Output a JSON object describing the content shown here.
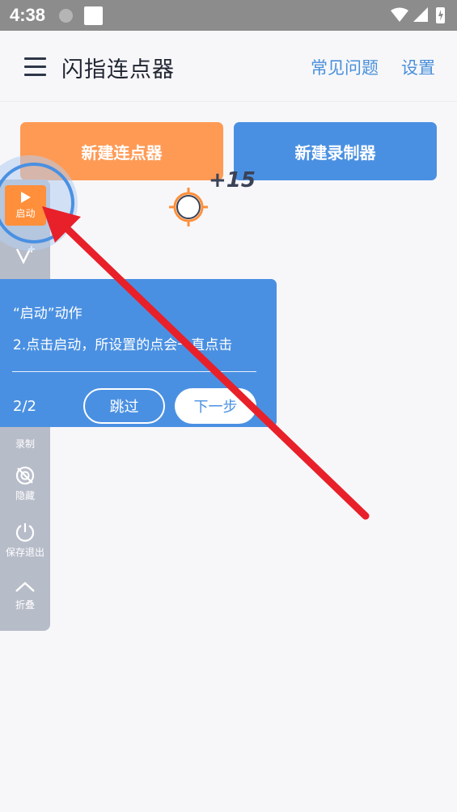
{
  "status_bar": {
    "time": "4:38"
  },
  "header": {
    "title": "闪指连点器",
    "faq_label": "常见问题",
    "settings_label": "设置"
  },
  "main": {
    "new_clicker_label": "新建连点器",
    "new_recorder_label": "新建录制器",
    "click_count_label": "+15"
  },
  "side_panel": {
    "start_label": "启动",
    "record_label": "录制",
    "hide_label": "隐藏",
    "save_exit_label": "保存退出",
    "collapse_label": "折叠"
  },
  "tooltip": {
    "title": "“启动”动作",
    "description": "2.点击启动，所设置的点会一直点击",
    "step": "2/2",
    "skip_label": "跳过",
    "next_label": "下一步"
  },
  "colors": {
    "orange": "#ff9a55",
    "blue": "#4a90e2",
    "arrow_red": "#e8202a",
    "panel_gray": "#b7bcc9"
  }
}
